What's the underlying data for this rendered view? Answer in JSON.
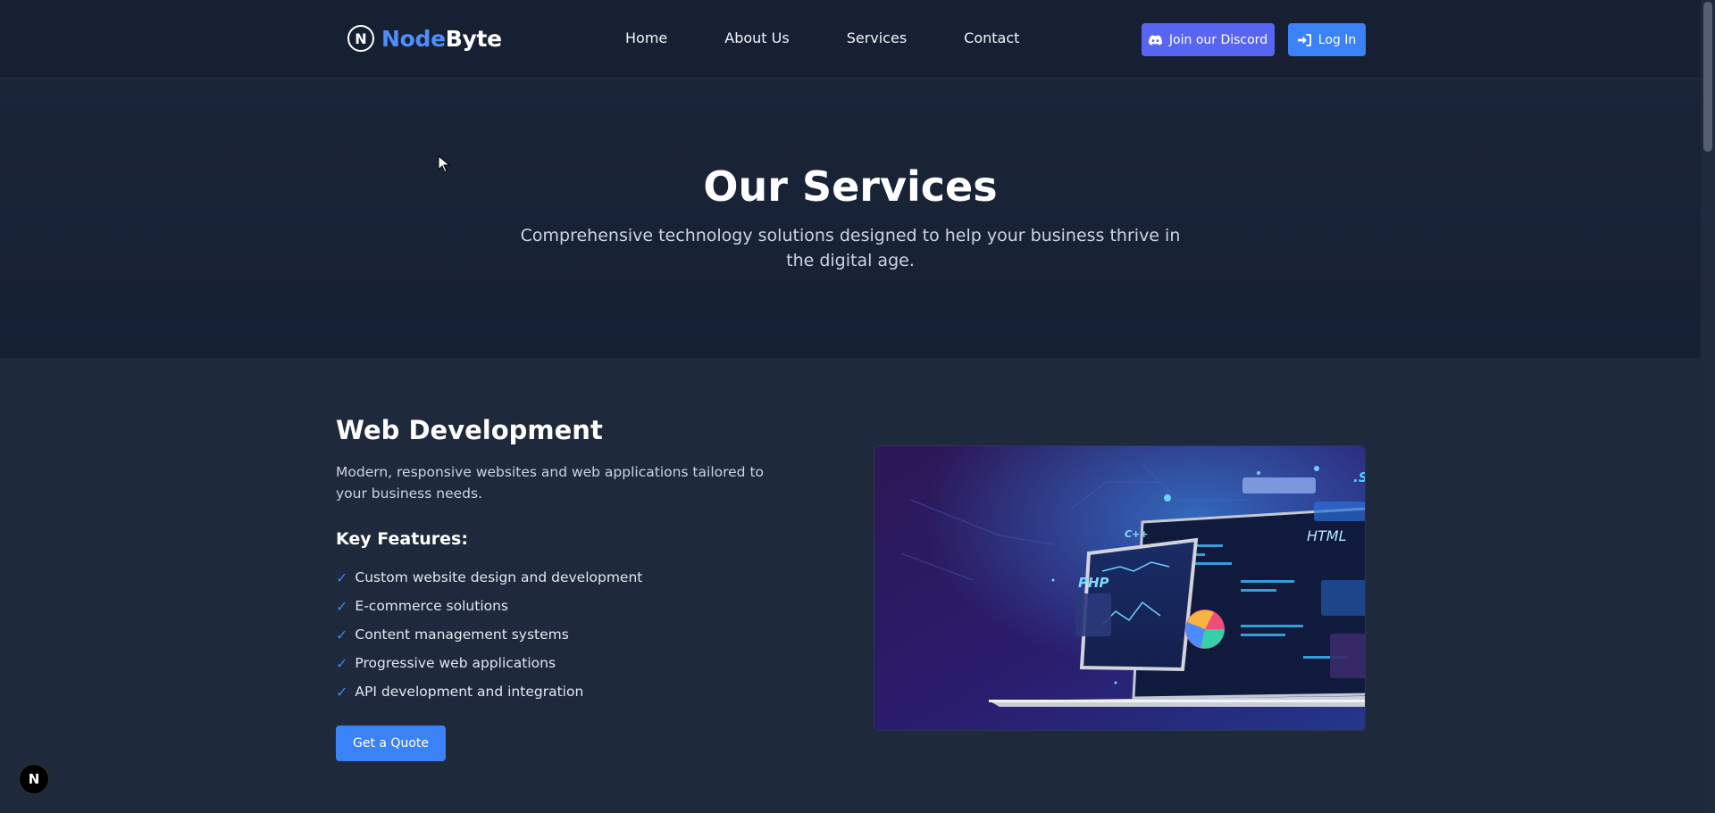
{
  "brand": {
    "part1": "Node",
    "part2": "Byte",
    "logo_glyph": "N"
  },
  "nav": {
    "links": [
      "Home",
      "About Us",
      "Services",
      "Contact"
    ],
    "discord_label": "Join our Discord",
    "login_label": "Log In"
  },
  "hero": {
    "title": "Our Services",
    "subtitle": "Comprehensive technology solutions designed to help your business thrive in the digital age."
  },
  "service": {
    "title": "Web Development",
    "description": "Modern, responsive websites and web applications tailored to your business needs.",
    "features_heading": "Key Features:",
    "features": [
      "Custom website design and development",
      "E-commerce solutions",
      "Content management systems",
      "Progressive web applications",
      "API development and integration"
    ],
    "cta": "Get a Quote",
    "image_labels": [
      "C++",
      "PHP",
      "HTML",
      ".S"
    ]
  },
  "dev_badge": "N",
  "colors": {
    "accent": "#3b82f6",
    "discord": "#5865f2",
    "bg": "#1e293b",
    "nav_bg": "#172033"
  },
  "icons": [
    "discord-icon",
    "login-icon",
    "check-icon",
    "cursor-icon"
  ]
}
